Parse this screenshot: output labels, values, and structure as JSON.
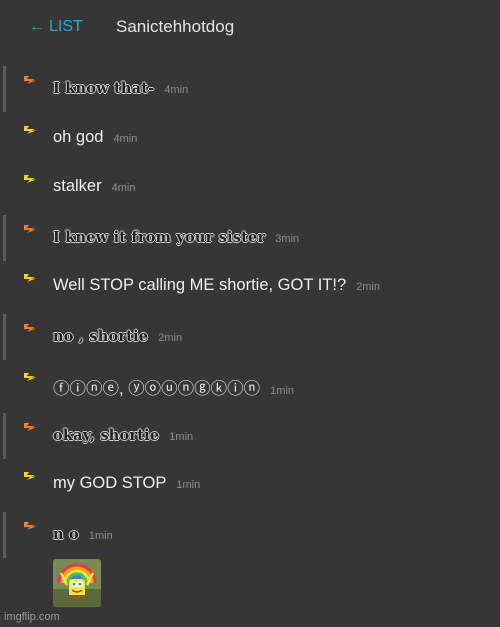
{
  "header": {
    "back_arrow": "←",
    "back_label": "LIST",
    "title": "Sanictehhotdog"
  },
  "messages": [
    {
      "text": "I know that-",
      "time": "4min",
      "style": "bold",
      "badge_color": "#ff7b2a"
    },
    {
      "text": "oh god",
      "time": "4min",
      "style": "plain",
      "badge_color": "#f4d21c"
    },
    {
      "text": "stalker",
      "time": "4min",
      "style": "plain",
      "badge_color": "#f4d21c"
    },
    {
      "text": "I knew it from your sister",
      "time": "3min",
      "style": "bold",
      "badge_color": "#ff7b2a"
    },
    {
      "text": "Well STOP calling ME shortie, GOT IT!?",
      "time": "2min",
      "style": "plain",
      "badge_color": "#f4d21c"
    },
    {
      "text": "no , shortie",
      "time": "2min",
      "style": "bold",
      "badge_color": "#ff7b2a"
    },
    {
      "text": "ⓕⓘⓝⓔ, ⓨⓞⓤⓝⓖⓚⓘⓝ",
      "time": "1min",
      "style": "plain",
      "badge_color": "#f4d21c"
    },
    {
      "text": "okay, shortie",
      "time": "1min",
      "style": "bold",
      "badge_color": "#ff7b2a"
    },
    {
      "text": "my GOD STOP",
      "time": "1min",
      "style": "plain",
      "badge_color": "#f4d21c"
    },
    {
      "text": "n o",
      "time": "1min",
      "style": "bold",
      "badge_color": "#ff7b2a"
    }
  ],
  "attachment": {
    "icon": "spongebob-imagination-icon"
  },
  "watermark": "imgflip.com"
}
